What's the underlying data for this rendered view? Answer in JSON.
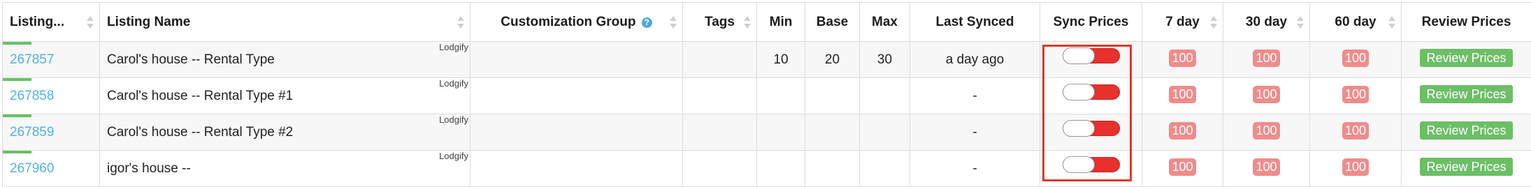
{
  "columns": {
    "id": "Listing...",
    "name": "Listing Name",
    "customization_group": "Customization Group",
    "tags": "Tags",
    "min": "Min",
    "base": "Base",
    "max": "Max",
    "last_synced": "Last Synced",
    "sync_prices": "Sync Prices",
    "d7": "7 day",
    "d30": "30 day",
    "d60": "60 day",
    "review_prices": "Review Prices"
  },
  "help_icon_glyph": "?",
  "rows": [
    {
      "id": "267857",
      "name": "Carol's house -- Rental Type",
      "source": "Lodgify",
      "customization_group": "",
      "tags": "",
      "min": "10",
      "base": "20",
      "max": "30",
      "last_synced": "a day ago",
      "sync_on": false,
      "d7": "100",
      "d30": "100",
      "d60": "100",
      "review_label": "Review Prices"
    },
    {
      "id": "267858",
      "name": "Carol's house -- Rental Type #1",
      "source": "Lodgify",
      "customization_group": "",
      "tags": "",
      "min": "",
      "base": "",
      "max": "",
      "last_synced": "-",
      "sync_on": false,
      "d7": "100",
      "d30": "100",
      "d60": "100",
      "review_label": "Review Prices"
    },
    {
      "id": "267859",
      "name": "Carol's house -- Rental Type #2",
      "source": "Lodgify",
      "customization_group": "",
      "tags": "",
      "min": "",
      "base": "",
      "max": "",
      "last_synced": "-",
      "sync_on": false,
      "d7": "100",
      "d30": "100",
      "d60": "100",
      "review_label": "Review Prices"
    },
    {
      "id": "267960",
      "name": "igor's house --",
      "source": "Lodgify",
      "customization_group": "",
      "tags": "",
      "min": "",
      "base": "",
      "max": "",
      "last_synced": "-",
      "sync_on": false,
      "d7": "100",
      "d30": "100",
      "d60": "100",
      "review_label": "Review Prices"
    }
  ],
  "colors": {
    "link": "#4fb3e0",
    "toggle_off": "#e8302d",
    "occupancy_pill": "#ef8c8c",
    "review_button": "#6cbf66",
    "highlight": "#d93a2b",
    "row_status_bar": "#6cbf66"
  }
}
